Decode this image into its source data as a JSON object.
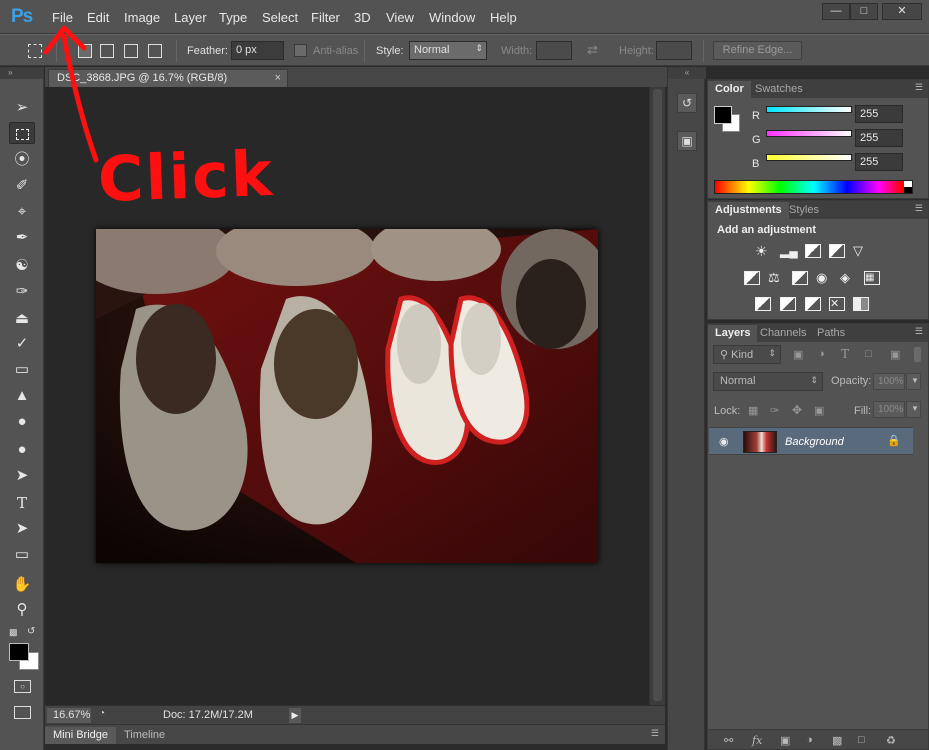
{
  "app": {
    "logo": "Ps",
    "menu": [
      "File",
      "Edit",
      "Image",
      "Layer",
      "Type",
      "Select",
      "Filter",
      "3D",
      "View",
      "Window",
      "Help"
    ],
    "window_controls": [
      "minimize-icon",
      "maximize-icon",
      "close-icon"
    ]
  },
  "options": {
    "feather_label": "Feather:",
    "feather_value": "0 px",
    "antialias_label": "Anti-alias",
    "style_label": "Style:",
    "style_value": "Normal",
    "width_label": "Width:",
    "height_label": "Height:",
    "refine_label": "Refine Edge..."
  },
  "toolbar": {
    "tools": [
      "move-icon",
      "rect-marquee-icon",
      "lasso-icon",
      "quick-select-icon",
      "crop-icon",
      "eyedropper-icon",
      "healing-brush-icon",
      "brush-icon",
      "clone-stamp-icon",
      "history-brush-icon",
      "eraser-icon",
      "paint-bucket-icon",
      "blur-icon",
      "dodge-icon",
      "pen-icon",
      "type-icon",
      "path-select-icon",
      "rectangle-shape-icon",
      "hand-icon",
      "zoom-icon"
    ],
    "foreground": "#000000",
    "background": "#ffffff"
  },
  "document": {
    "tab_title": "DSC_3868.JPG @ 16.7% (RGB/8)",
    "zoom": "16.67%",
    "doc_size": "Doc: 17.2M/17.2M"
  },
  "bottom_tabs": [
    "Mini Bridge",
    "Timeline"
  ],
  "color_panel": {
    "tabs": [
      "Color",
      "Swatches"
    ],
    "channels": [
      {
        "label": "R",
        "value": "255",
        "color": "#00e5ff"
      },
      {
        "label": "G",
        "value": "255",
        "color": "#ff30ff"
      },
      {
        "label": "B",
        "value": "255",
        "color": "#ffff30"
      }
    ]
  },
  "adjustments_panel": {
    "tabs": [
      "Adjustments",
      "Styles"
    ],
    "title": "Add an adjustment"
  },
  "layers_panel": {
    "tabs": [
      "Layers",
      "Channels",
      "Paths"
    ],
    "filter_label": "Kind",
    "blend_mode": "Normal",
    "opacity_label": "Opacity:",
    "opacity_value": "100%",
    "lock_label": "Lock:",
    "fill_label": "Fill:",
    "fill_value": "100%",
    "layers": [
      {
        "name": "Background",
        "locked": true,
        "visible": true
      }
    ]
  },
  "annotation": {
    "text": "Click",
    "color": "#ff1010"
  }
}
